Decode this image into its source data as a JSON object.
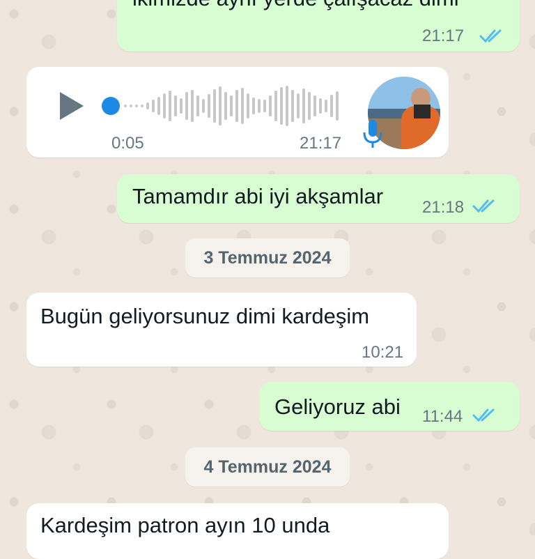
{
  "messages": [
    {
      "text": "ikimizde aynı yerde çalışacaz dimi",
      "time": "21:17"
    },
    {
      "duration": "0:05",
      "time": "21:17"
    },
    {
      "text": "Tamamdır abi iyi akşamlar",
      "time": "21:18"
    },
    {
      "text": "Bugün geliyorsunuz dimi kardeşim",
      "time": "10:21"
    },
    {
      "text": "Geliyoruz abi",
      "time": "11:44"
    },
    {
      "text": "Kardeşim patron ayın 10 unda"
    }
  ],
  "dates": [
    "3 Temmuz 2024",
    "4 Temmuz 2024"
  ],
  "colors": {
    "outgoing_bubble": "#d9fdd3",
    "incoming_bubble": "#ffffff",
    "read_ticks": "#53bdeb",
    "voice_accent": "#1e88e5"
  },
  "icons": [
    "double-check-icon",
    "play-icon",
    "microphone-icon"
  ]
}
